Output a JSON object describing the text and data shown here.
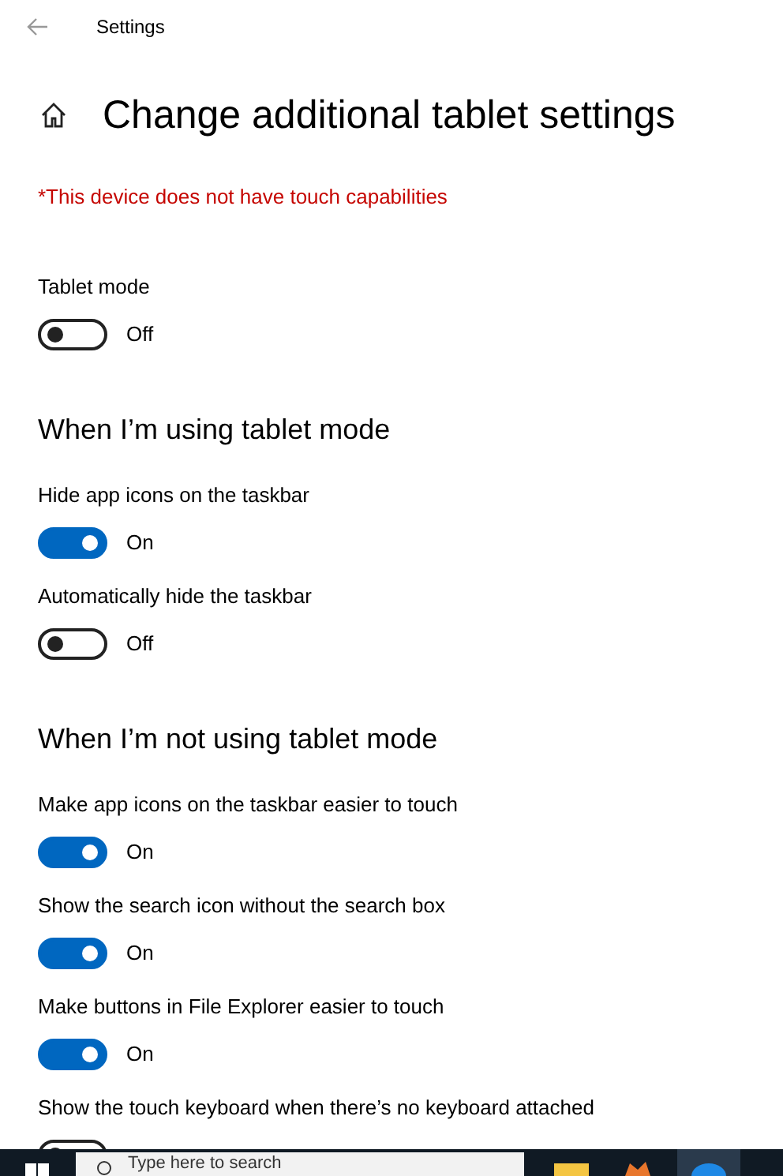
{
  "window": {
    "title": "Settings"
  },
  "page": {
    "title": "Change additional tablet settings",
    "warning": "*This device does not have touch capabilities"
  },
  "sections": [
    {
      "settings": [
        {
          "label": "Tablet mode",
          "on": false,
          "state_text": "Off"
        }
      ]
    },
    {
      "heading": "When I’m using tablet mode",
      "settings": [
        {
          "label": "Hide app icons on the taskbar",
          "on": true,
          "state_text": "On"
        },
        {
          "label": "Automatically hide the taskbar",
          "on": false,
          "state_text": "Off"
        }
      ]
    },
    {
      "heading": "When I’m not using tablet mode",
      "settings": [
        {
          "label": "Make app icons on the taskbar easier to touch",
          "on": true,
          "state_text": "On"
        },
        {
          "label": "Show the search icon without the search box",
          "on": true,
          "state_text": "On"
        },
        {
          "label": "Make buttons in File Explorer easier to touch",
          "on": true,
          "state_text": "On"
        },
        {
          "label": "Show the touch keyboard when there’s no keyboard attached",
          "on": false
        }
      ]
    }
  ],
  "taskbar": {
    "search_placeholder": "Type here to search"
  }
}
